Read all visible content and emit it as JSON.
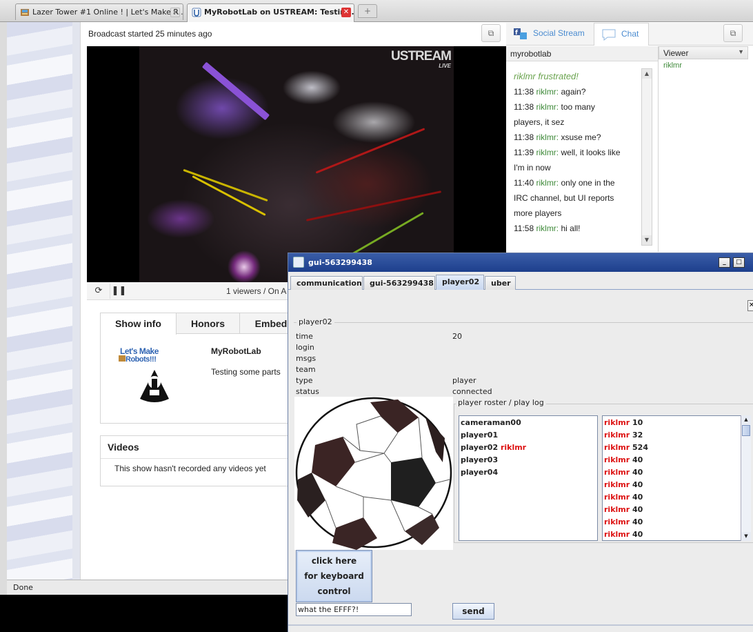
{
  "browser": {
    "tabs": [
      {
        "title": "Lazer Tower #1 Online ! | Let's Make R...",
        "active": false
      },
      {
        "title": "MyRobotLab on USTREAM: Testin...",
        "active": true
      }
    ],
    "new_tab": "+",
    "status": "Done"
  },
  "page": {
    "broadcast": "Broadcast started 25 minutes ago",
    "ustream_logo": "USTREAM",
    "ustream_live": "LIVE",
    "viewers": "1 viewers / On A",
    "info_tabs": [
      "Show info",
      "Honors",
      "Embed"
    ],
    "lmr_logo": "Let's Make Robots!!!",
    "lmr_badge": "MYROBOTLAB",
    "show_name": "MyRobotLab",
    "show_desc": "Testing some parts",
    "videos_title": "Videos",
    "videos_text": "This show hasn't recorded any videos yet"
  },
  "chat": {
    "tabs": [
      "Social Stream",
      "Chat"
    ],
    "channel": "myrobotlab",
    "system": "riklmr frustrated!",
    "lines": [
      {
        "time": "11:38",
        "nick": "riklmr:",
        "text": "again?"
      },
      {
        "time": "11:38",
        "nick": "riklmr:",
        "text": "too many"
      },
      {
        "time": "",
        "nick": "",
        "text": "players, it sez"
      },
      {
        "time": "11:38",
        "nick": "riklmr:",
        "text": "xsuse me?"
      },
      {
        "time": "11:39",
        "nick": "riklmr:",
        "text": "well, it looks like"
      },
      {
        "time": "",
        "nick": "",
        "text": "I'm in now"
      },
      {
        "time": "11:40",
        "nick": "riklmr:",
        "text": "only one in the"
      },
      {
        "time": "",
        "nick": "",
        "text": "IRC channel, but UI reports"
      },
      {
        "time": "",
        "nick": "",
        "text": "more players"
      },
      {
        "time": "11:58",
        "nick": "riklmr:",
        "text": "hi all!"
      }
    ],
    "viewer_header": "Viewer",
    "viewers": [
      "riklmr"
    ]
  },
  "java": {
    "title": "gui-563299438",
    "tabs": [
      "communication",
      "gui-563299438",
      "player02",
      "uber"
    ],
    "active_tab": "player02",
    "group_label": "player02",
    "fields": [
      {
        "key": "time",
        "value": "20"
      },
      {
        "key": "login",
        "value": ""
      },
      {
        "key": "msgs",
        "value": ""
      },
      {
        "key": "team",
        "value": ""
      },
      {
        "key": "type",
        "value": "player"
      },
      {
        "key": "status",
        "value": "connected"
      }
    ],
    "roster_label": "player roster / play log",
    "roster": [
      {
        "name": "cameraman00",
        "user": ""
      },
      {
        "name": "player01",
        "user": ""
      },
      {
        "name": "player02",
        "user": "riklmr"
      },
      {
        "name": "player03",
        "user": ""
      },
      {
        "name": "player04",
        "user": ""
      }
    ],
    "playlog": [
      {
        "user": "riklmr",
        "value": "10"
      },
      {
        "user": "riklmr",
        "value": "32"
      },
      {
        "user": "riklmr",
        "value": "524"
      },
      {
        "user": "riklmr",
        "value": "40"
      },
      {
        "user": "riklmr",
        "value": "40"
      },
      {
        "user": "riklmr",
        "value": "40"
      },
      {
        "user": "riklmr",
        "value": "40"
      },
      {
        "user": "riklmr",
        "value": "40"
      },
      {
        "user": "riklmr",
        "value": "40"
      },
      {
        "user": "riklmr",
        "value": "40"
      }
    ],
    "keyboard_button": [
      "click here",
      "for keyboard",
      "control"
    ],
    "message_value": "what the EFFF?!",
    "send_label": "send"
  },
  "icons": {
    "tab_close": "close-icon",
    "popout": "popout-icon",
    "reload": "reload-icon",
    "pause": "pause-icon",
    "social": "social-icon",
    "chat": "chat-bubble-icon"
  },
  "colors": {
    "nick_green": "#3f8a3a",
    "roster_red": "#d11111",
    "swing_title": "#1d3f8c",
    "chat_tab_blue": "#4a8bd0"
  }
}
